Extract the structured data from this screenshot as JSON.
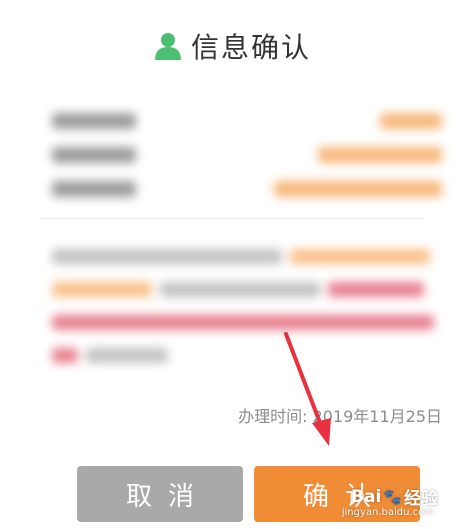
{
  "dialog": {
    "title": "信息确认",
    "date_text": "办理时间: 2019年11月25日"
  },
  "buttons": {
    "cancel_label": "取消",
    "confirm_label": "确认"
  },
  "watermark": {
    "text_bai": "Bai",
    "text_jingyan": "经验",
    "url": "jingyan.baidu.com"
  },
  "colors": {
    "title_icon": "#4cbf73",
    "cancel_bg": "#a9a9a9",
    "confirm_bg": "#f08c35",
    "arrow": "#e8303f"
  },
  "icons": {
    "title": "user-icon",
    "annotation": "red-arrow"
  }
}
